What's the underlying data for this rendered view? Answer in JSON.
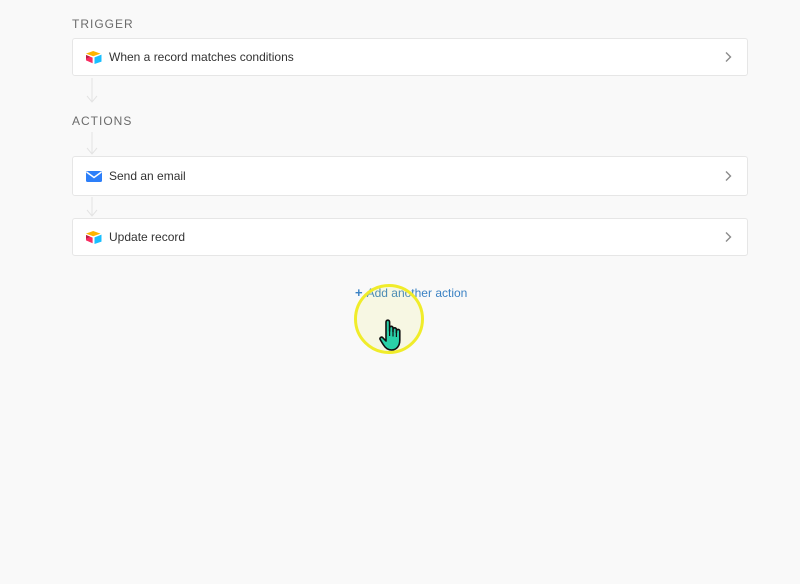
{
  "sections": {
    "trigger_label": "TRIGGER",
    "actions_label": "ACTIONS"
  },
  "trigger": {
    "label": "When a record matches conditions",
    "icon": "airtable-logo-icon"
  },
  "actions": [
    {
      "label": "Send an email",
      "icon": "email-icon"
    },
    {
      "label": "Update record",
      "icon": "airtable-logo-icon"
    }
  ],
  "add_action": {
    "plus": "+",
    "label": "Add another action"
  },
  "colors": {
    "background": "#f9f9f9",
    "card": "#ffffff",
    "link": "#3b82c4",
    "cursor_highlight": "#f0ec2a",
    "cursor_hand": "#2ad1a8"
  }
}
